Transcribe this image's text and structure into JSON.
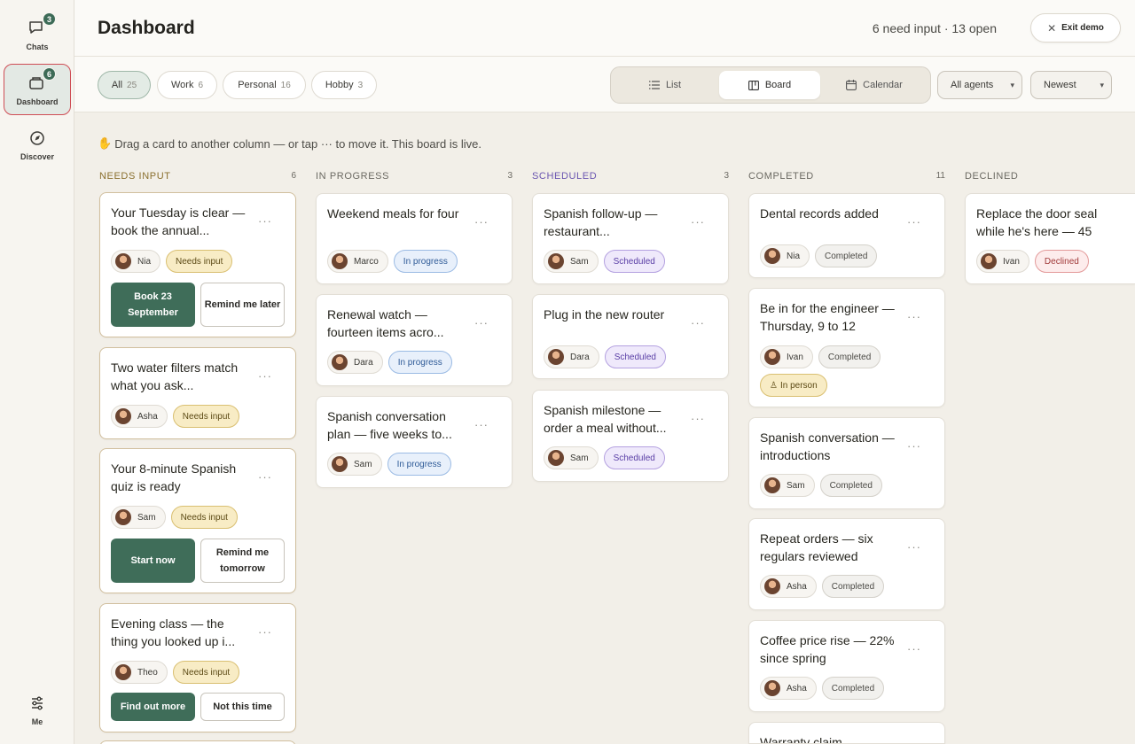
{
  "sidebar": {
    "items": [
      {
        "label": "Chats",
        "badge": "3"
      },
      {
        "label": "Dashboard",
        "badge": "6"
      },
      {
        "label": "Discover"
      },
      {
        "label": "Me"
      }
    ]
  },
  "header": {
    "title": "Dashboard",
    "status": "6 need input · 13 open",
    "exit_label": "Exit demo"
  },
  "filters": [
    {
      "label": "All",
      "count": "25"
    },
    {
      "label": "Work",
      "count": "6"
    },
    {
      "label": "Personal",
      "count": "16"
    },
    {
      "label": "Hobby",
      "count": "3"
    }
  ],
  "views": [
    {
      "label": "List"
    },
    {
      "label": "Board"
    },
    {
      "label": "Calendar"
    }
  ],
  "selects": {
    "agents": "All agents",
    "sort": "Newest"
  },
  "hint": "Drag a card to another column — or tap ··· to move it. This board is live.",
  "columns": [
    {
      "title": "NEEDS INPUT",
      "count": "6",
      "cards": [
        {
          "title": "Your Tuesday is clear — book the annual...",
          "person": "Nia",
          "status": "Needs input",
          "primary": "Book 23 September",
          "secondary": "Remind me later"
        },
        {
          "title": "Two water filters match what you ask...",
          "person": "Asha",
          "status": "Needs input"
        },
        {
          "title": "Your 8-minute Spanish quiz is ready",
          "person": "Sam",
          "status": "Needs input",
          "primary": "Start now",
          "secondary": "Remind me tomorrow"
        },
        {
          "title": "Evening class — the thing you looked up i...",
          "person": "Theo",
          "status": "Needs input",
          "primary": "Find out more",
          "secondary": "Not this time"
        }
      ]
    },
    {
      "title": "IN PROGRESS",
      "count": "3",
      "cards": [
        {
          "title": "Weekend meals for four",
          "person": "Marco",
          "status": "In progress"
        },
        {
          "title": "Renewal watch — fourteen items acro...",
          "person": "Dara",
          "status": "In progress"
        },
        {
          "title": "Spanish conversation plan — five weeks to...",
          "person": "Sam",
          "status": "In progress"
        }
      ]
    },
    {
      "title": "SCHEDULED",
      "count": "3",
      "cards": [
        {
          "title": "Spanish follow-up — restaurant...",
          "person": "Sam",
          "status": "Scheduled"
        },
        {
          "title": "Plug in the new router",
          "person": "Dara",
          "status": "Scheduled"
        },
        {
          "title": "Spanish milestone — order a meal without...",
          "person": "Sam",
          "status": "Scheduled"
        }
      ]
    },
    {
      "title": "COMPLETED",
      "count": "11",
      "cards": [
        {
          "title": "Dental records added",
          "person": "Nia",
          "status": "Completed"
        },
        {
          "title": "Be in for the engineer — Thursday, 9 to 12",
          "person": "Ivan",
          "status": "Completed",
          "extra": "In person"
        },
        {
          "title": "Spanish conversation — introductions",
          "person": "Sam",
          "status": "Completed"
        },
        {
          "title": "Repeat orders — six regulars reviewed",
          "person": "Asha",
          "status": "Completed"
        },
        {
          "title": "Coffee price rise — 22% since spring",
          "person": "Asha",
          "status": "Completed"
        },
        {
          "title": "Warranty claim —"
        }
      ]
    },
    {
      "title": "DECLINED",
      "count": "",
      "cards": [
        {
          "title": "Replace the door seal while he's here — 45",
          "person": "Ivan",
          "status": "Declined"
        }
      ]
    }
  ],
  "colors": {
    "accent": "#3f6d59",
    "needs_input": "#f8ecc5",
    "in_progress": "#e8f0fb",
    "scheduled": "#efe9fb",
    "declined": "#fdecec"
  }
}
